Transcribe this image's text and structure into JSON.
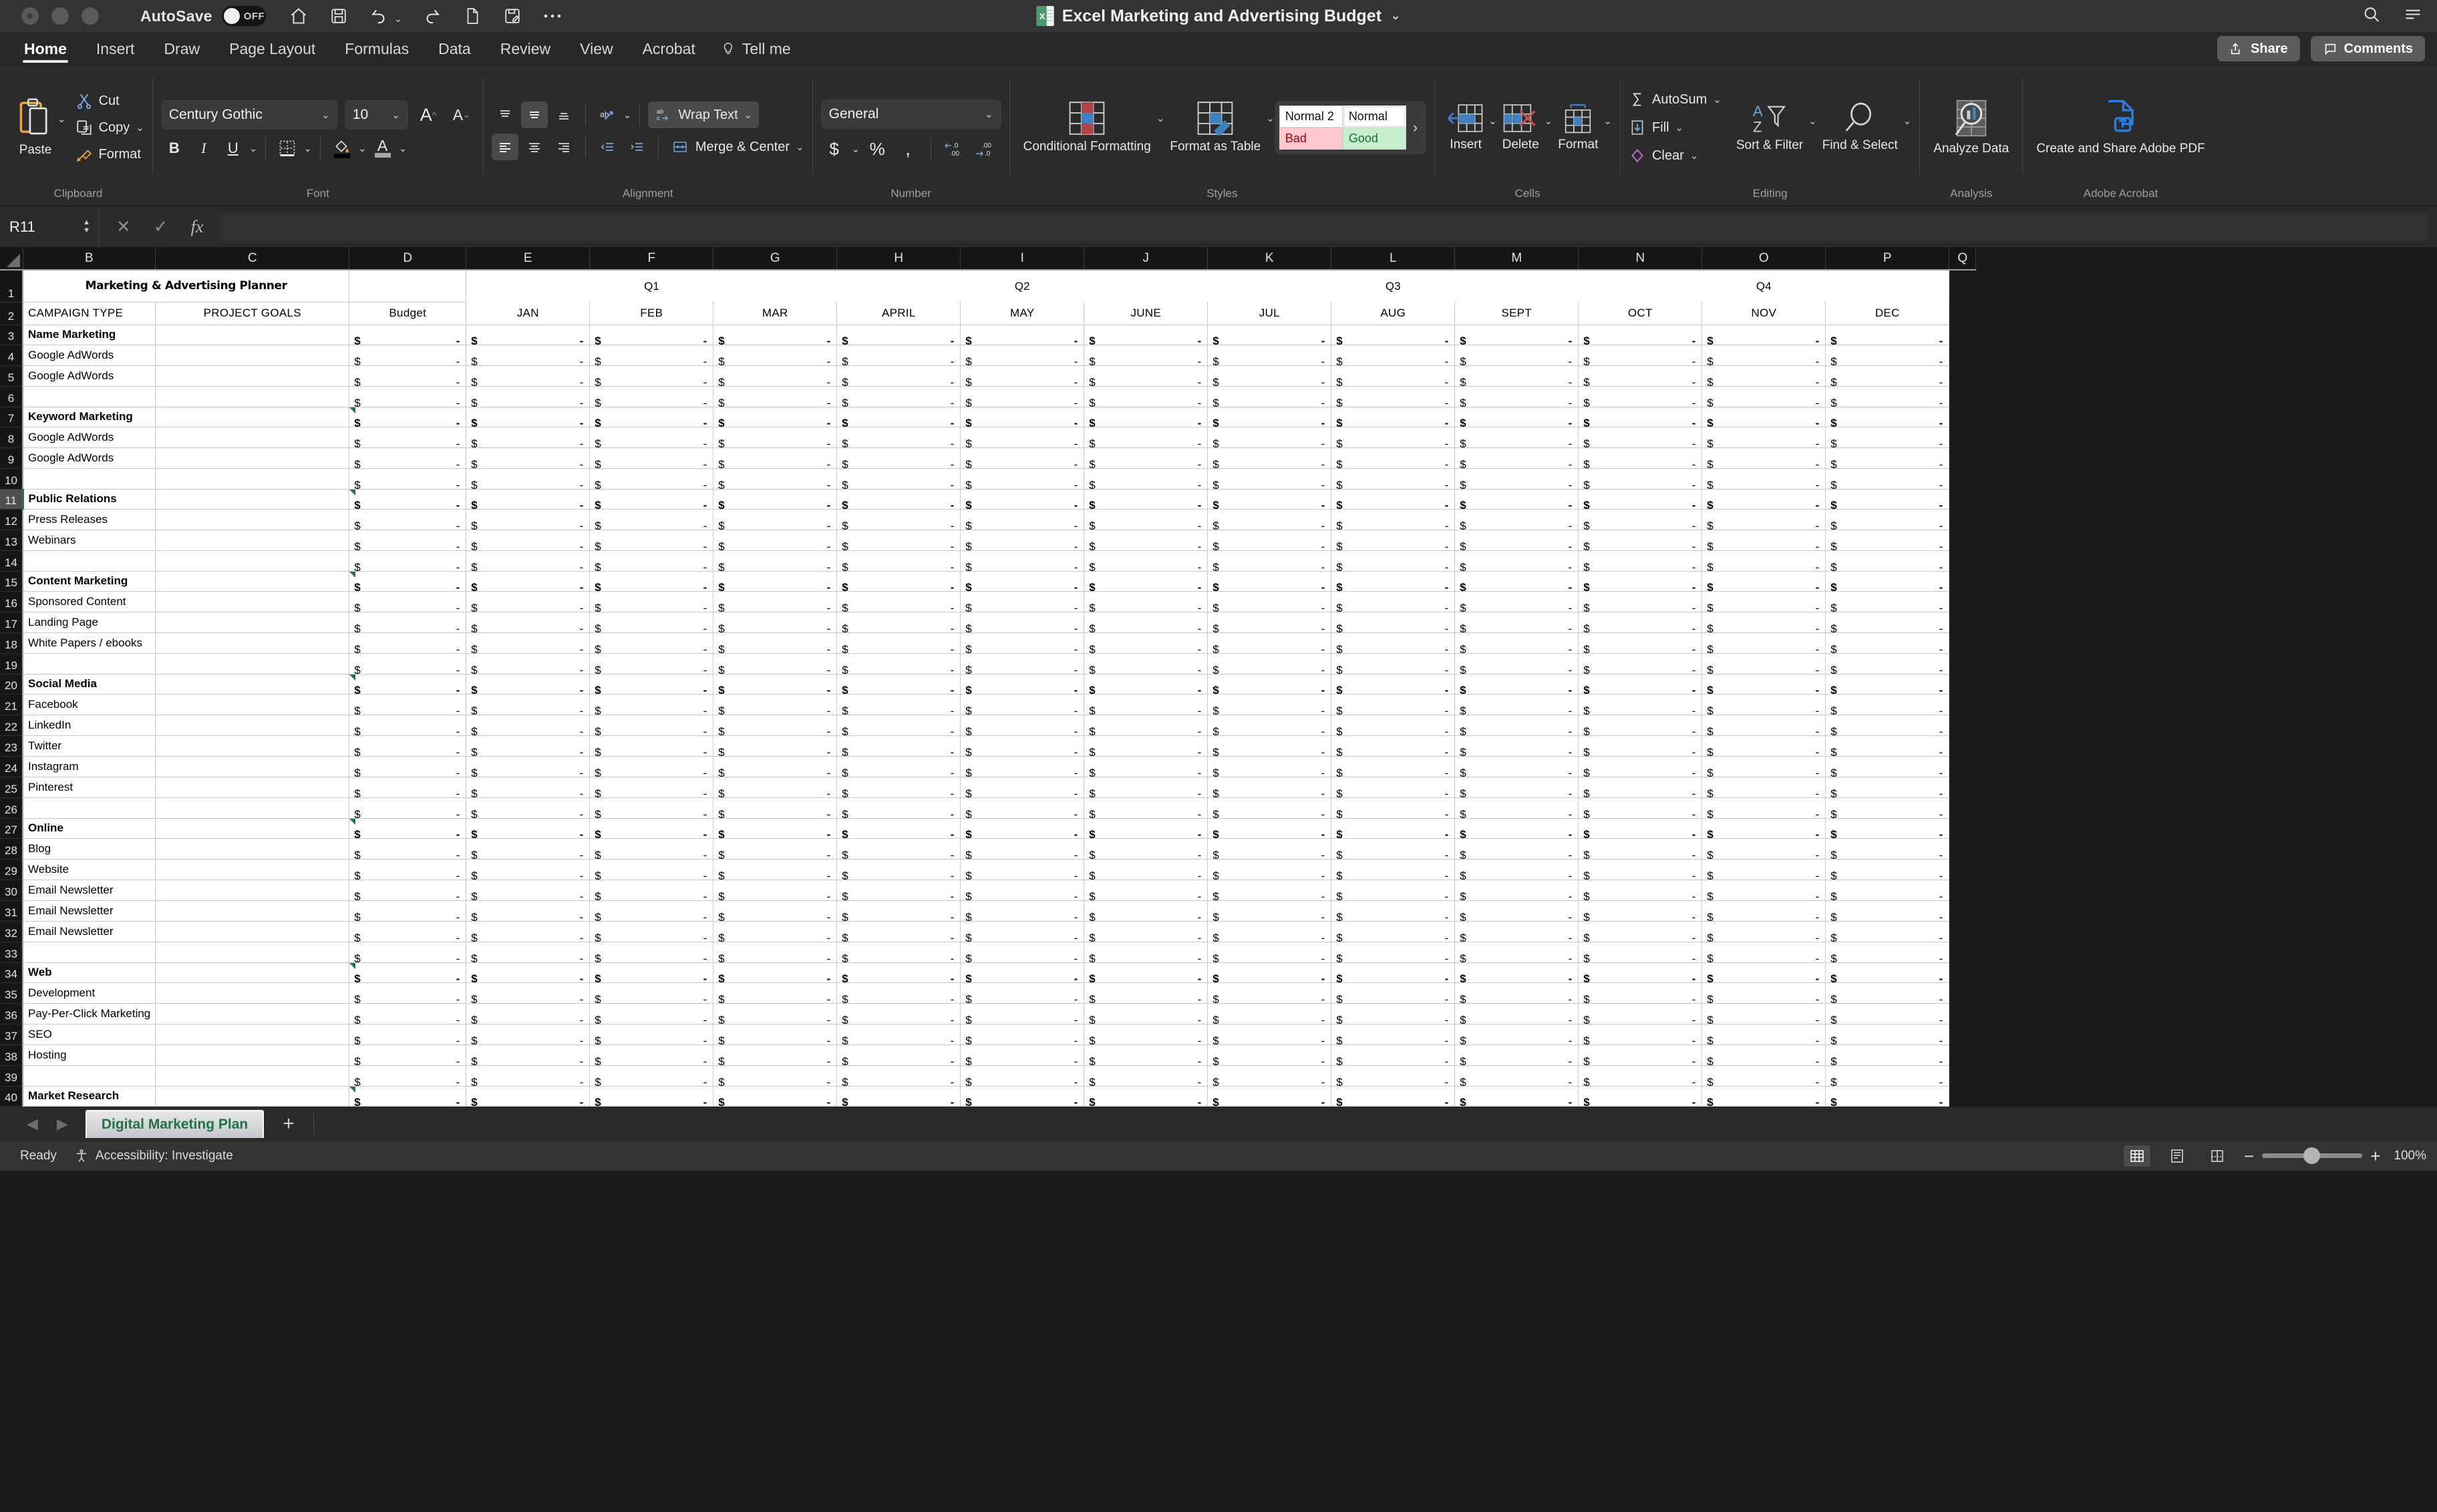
{
  "titlebar": {
    "autosave_label": "AutoSave",
    "autosave_state": "OFF",
    "document_title": "Excel Marketing and Advertising Budget",
    "quick_access": [
      "home-icon",
      "save-icon",
      "undo-icon",
      "redo-icon",
      "new-icon",
      "save-as-icon",
      "more-icon"
    ],
    "right_icons": [
      "search-icon",
      "ribbon-display-icon"
    ]
  },
  "tabs": {
    "items": [
      {
        "label": "Home",
        "active": true
      },
      {
        "label": "Insert",
        "active": false
      },
      {
        "label": "Draw",
        "active": false
      },
      {
        "label": "Page Layout",
        "active": false
      },
      {
        "label": "Formulas",
        "active": false
      },
      {
        "label": "Data",
        "active": false
      },
      {
        "label": "Review",
        "active": false
      },
      {
        "label": "View",
        "active": false
      },
      {
        "label": "Acrobat",
        "active": false
      }
    ],
    "tell_me": "Tell me",
    "share": "Share",
    "comments": "Comments"
  },
  "ribbon": {
    "clipboard": {
      "label": "Clipboard",
      "paste": "Paste",
      "cut": "Cut",
      "copy": "Copy",
      "format_painter": "Format"
    },
    "font": {
      "label": "Font",
      "family": "Century Gothic",
      "size": "10",
      "bold": "B",
      "italic": "I",
      "underline": "U"
    },
    "alignment": {
      "label": "Alignment",
      "wrap_text": "Wrap Text",
      "merge_center": "Merge & Center"
    },
    "number": {
      "label": "Number",
      "format": "General",
      "currency": "$",
      "percent": "%",
      "comma": ","
    },
    "styles": {
      "label": "Styles",
      "conditional_formatting": "Conditional Formatting",
      "format_as_table": "Format as Table",
      "gallery": [
        {
          "name": "Normal 2",
          "class": "sg-normal2"
        },
        {
          "name": "Normal",
          "class": "sg-normal"
        },
        {
          "name": "Bad",
          "class": "sg-bad"
        },
        {
          "name": "Good",
          "class": "sg-good"
        }
      ]
    },
    "cells": {
      "label": "Cells",
      "insert": "Insert",
      "delete": "Delete",
      "format": "Format"
    },
    "editing": {
      "label": "Editing",
      "autosum": "AutoSum",
      "fill": "Fill",
      "clear": "Clear",
      "sort_filter": "Sort & Filter",
      "find_select": "Find & Select"
    },
    "analysis": {
      "label": "Analysis",
      "analyze_data": "Analyze Data"
    },
    "acrobat": {
      "label": "Adobe Acrobat",
      "create_share_pdf": "Create and Share Adobe PDF"
    }
  },
  "formula_bar": {
    "name_box": "R11",
    "cancel_icon": "cancel-icon",
    "enter_icon": "confirm-icon",
    "fx": "fx",
    "value": ""
  },
  "sheet": {
    "column_headers": [
      "B",
      "C",
      "D",
      "E",
      "F",
      "G",
      "H",
      "I",
      "J",
      "K",
      "L",
      "M",
      "N",
      "O",
      "P",
      "Q"
    ],
    "title": "Marketing & Advertising Planner",
    "quarters": [
      {
        "label": "Q1",
        "span": 3
      },
      {
        "label": "Q2",
        "span": 3
      },
      {
        "label": "Q3",
        "span": 3
      },
      {
        "label": "Q4",
        "span": 3
      }
    ],
    "headers": {
      "campaign_type": "CAMPAIGN TYPE",
      "project_goals": "PROJECT GOALS",
      "budget": "Budget",
      "months": [
        "JAN",
        "FEB",
        "MAR",
        "APRIL",
        "MAY",
        "JUNE",
        "JUL",
        "AUG",
        "SEPT",
        "OCT",
        "NOV",
        "DEC"
      ]
    },
    "currency_symbol": "$",
    "zero_dash": "-",
    "rows": [
      {
        "n": 3,
        "type": "section",
        "label": "Name Marketing",
        "note": false
      },
      {
        "n": 4,
        "type": "item",
        "label": "Google AdWords"
      },
      {
        "n": 5,
        "type": "item",
        "label": "Google AdWords"
      },
      {
        "n": 6,
        "type": "item",
        "label": ""
      },
      {
        "n": 7,
        "type": "section",
        "label": "Keyword Marketing",
        "note": true
      },
      {
        "n": 8,
        "type": "item",
        "label": "Google AdWords"
      },
      {
        "n": 9,
        "type": "item",
        "label": "Google AdWords"
      },
      {
        "n": 10,
        "type": "item",
        "label": ""
      },
      {
        "n": 11,
        "type": "section",
        "label": "Public Relations",
        "note": true,
        "selected": true
      },
      {
        "n": 12,
        "type": "item",
        "label": "Press Releases"
      },
      {
        "n": 13,
        "type": "item",
        "label": "Webinars"
      },
      {
        "n": 14,
        "type": "item",
        "label": ""
      },
      {
        "n": 15,
        "type": "section",
        "label": "Content Marketing",
        "note": true
      },
      {
        "n": 16,
        "type": "item",
        "label": "Sponsored Content"
      },
      {
        "n": 17,
        "type": "item",
        "label": "Landing Page"
      },
      {
        "n": 18,
        "type": "item",
        "label": "White Papers / ebooks"
      },
      {
        "n": 19,
        "type": "item",
        "label": ""
      },
      {
        "n": 20,
        "type": "section",
        "label": "Social Media",
        "note": true
      },
      {
        "n": 21,
        "type": "item",
        "label": "Facebook"
      },
      {
        "n": 22,
        "type": "item",
        "label": "LinkedIn"
      },
      {
        "n": 23,
        "type": "item",
        "label": "Twitter"
      },
      {
        "n": 24,
        "type": "item",
        "label": "Instagram"
      },
      {
        "n": 25,
        "type": "item",
        "label": "Pinterest"
      },
      {
        "n": 26,
        "type": "item",
        "label": ""
      },
      {
        "n": 27,
        "type": "section",
        "label": "Online",
        "note": true
      },
      {
        "n": 28,
        "type": "item",
        "label": "Blog"
      },
      {
        "n": 29,
        "type": "item",
        "label": "Website"
      },
      {
        "n": 30,
        "type": "item",
        "label": "Email Newsletter"
      },
      {
        "n": 31,
        "type": "item",
        "label": "Email Newsletter"
      },
      {
        "n": 32,
        "type": "item",
        "label": "Email Newsletter"
      },
      {
        "n": 33,
        "type": "item",
        "label": ""
      },
      {
        "n": 34,
        "type": "section",
        "label": "Web",
        "note": true
      },
      {
        "n": 35,
        "type": "item",
        "label": "Development"
      },
      {
        "n": 36,
        "type": "item",
        "label": "Pay-Per-Click Marketing"
      },
      {
        "n": 37,
        "type": "item",
        "label": "SEO"
      },
      {
        "n": 38,
        "type": "item",
        "label": "Hosting"
      },
      {
        "n": 39,
        "type": "item",
        "label": ""
      },
      {
        "n": 40,
        "type": "section",
        "label": "Market Research",
        "note": true
      }
    ]
  },
  "sheet_tabs": {
    "active": "Digital Marketing Plan",
    "add": "+"
  },
  "status": {
    "state": "Ready",
    "accessibility": "Accessibility: Investigate",
    "zoom": "100%",
    "views": [
      "normal-view-icon",
      "page-layout-view-icon",
      "page-break-view-icon"
    ]
  }
}
